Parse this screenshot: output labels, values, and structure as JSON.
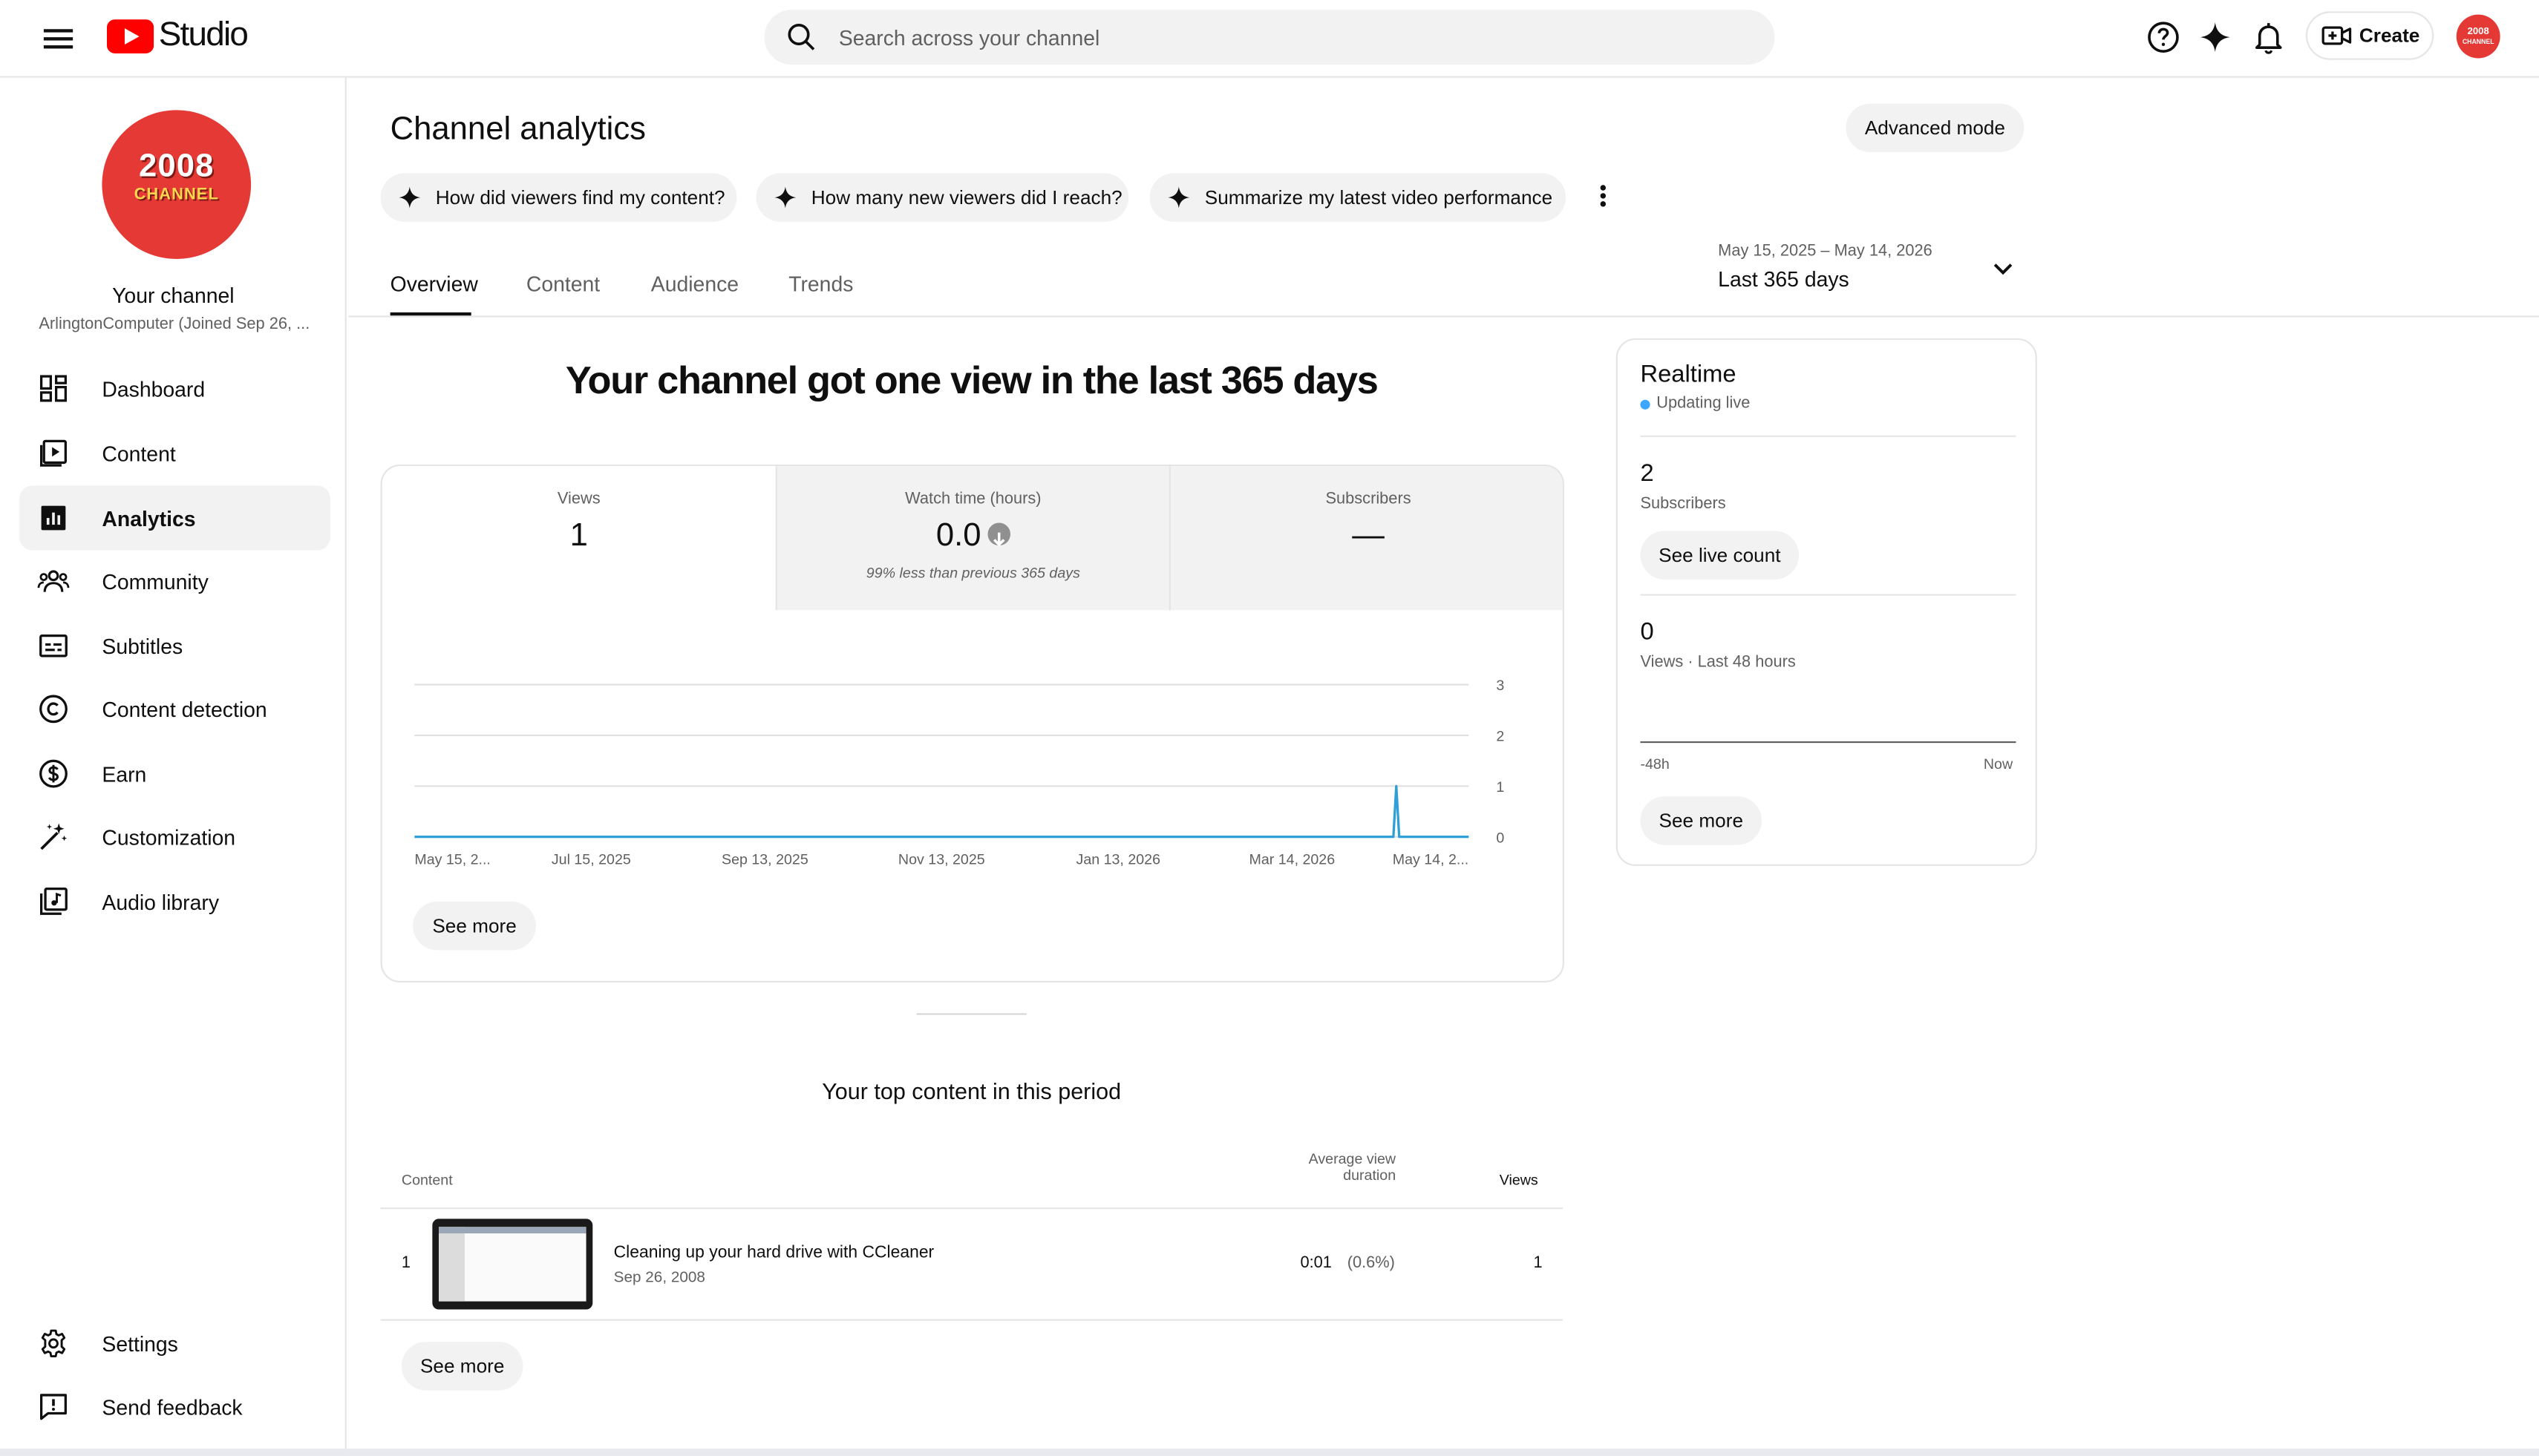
{
  "header": {
    "logo_text": "Studio",
    "search_placeholder": "Search across your channel",
    "create_label": "Create",
    "avatar_text_line1": "2008",
    "avatar_text_line2": "CHANNEL",
    "icons": [
      "menu-icon",
      "help-icon",
      "sparkle-icon",
      "notifications-icon",
      "create-video-icon"
    ]
  },
  "sidebar": {
    "avatar_line1": "2008",
    "avatar_line2": "CHANNEL",
    "title": "Your channel",
    "subtitle": "ArlingtonComputer (Joined Sep 26, ...",
    "items": [
      {
        "label": "Dashboard",
        "icon": "dashboard-icon",
        "active": false
      },
      {
        "label": "Content",
        "icon": "content-icon",
        "active": false
      },
      {
        "label": "Analytics",
        "icon": "analytics-icon",
        "active": true
      },
      {
        "label": "Community",
        "icon": "community-icon",
        "active": false
      },
      {
        "label": "Subtitles",
        "icon": "subtitles-icon",
        "active": false
      },
      {
        "label": "Content detection",
        "icon": "copyright-icon",
        "active": false
      },
      {
        "label": "Earn",
        "icon": "dollar-icon",
        "active": false
      },
      {
        "label": "Customization",
        "icon": "magic-wand-icon",
        "active": false
      },
      {
        "label": "Audio library",
        "icon": "audio-library-icon",
        "active": false
      }
    ],
    "bottom_items": [
      {
        "label": "Settings",
        "icon": "gear-icon"
      },
      {
        "label": "Send feedback",
        "icon": "feedback-icon"
      }
    ]
  },
  "main": {
    "title": "Channel analytics",
    "advanced_mode": "Advanced mode",
    "chips": [
      "How did viewers find my content?",
      "How many new viewers did I reach?",
      "Summarize my latest video performance"
    ],
    "tabs": [
      "Overview",
      "Content",
      "Audience",
      "Trends"
    ],
    "active_tab": "Overview",
    "date_range": "May 15, 2025 – May 14, 2026",
    "date_label": "Last 365 days",
    "headline": "Your channel got one view in the last 365 days",
    "metrics": [
      {
        "label": "Views",
        "value": "1",
        "note": ""
      },
      {
        "label": "Watch time (hours)",
        "value": "0.0",
        "note": "99% less than previous 365 days"
      },
      {
        "label": "Subscribers",
        "value": "—",
        "note": ""
      }
    ],
    "overview_see_more": "See more",
    "top_content": {
      "title": "Your top content in this period",
      "col_content": "Content",
      "col_avd_line1": "Average view",
      "col_avd_line2": "duration",
      "col_views": "Views",
      "rows": [
        {
          "rank": "1",
          "title": "Cleaning up your hard drive with CCleaner",
          "date": "Sep 26, 2008",
          "avd": "0:01",
          "avd_pct": "(0.6%)",
          "views": "1"
        }
      ],
      "see_more": "See more"
    }
  },
  "realtime": {
    "title": "Realtime",
    "status": "Updating live",
    "subscribers_value": "2",
    "subscribers_label": "Subscribers",
    "see_live_count": "See live count",
    "views_value": "0",
    "views_label": "Views · Last 48 hours",
    "axis_start": "-48h",
    "axis_end": "Now",
    "see_more": "See more"
  },
  "colors": {
    "accent_red": "#ff0000",
    "avatar_red": "#e53935",
    "line_blue": "#2f9fd8",
    "live_dot": "#3ea6ff"
  },
  "chart_data": {
    "type": "line",
    "title": "",
    "xlabel": "",
    "ylabel": "",
    "x_tick_labels": [
      "May 15, 2...",
      "Jul 15, 2025",
      "Sep 13, 2025",
      "Nov 13, 2025",
      "Jan 13, 2026",
      "Mar 14, 2026",
      "May 14, 2..."
    ],
    "x_tick_dates": [
      "2025-05-15",
      "2025-07-15",
      "2025-09-13",
      "2025-11-13",
      "2026-01-13",
      "2026-03-14",
      "2026-05-14"
    ],
    "x_range": [
      "2025-05-15",
      "2026-05-14"
    ],
    "y_ticks": [
      0,
      1,
      2,
      3
    ],
    "ylim": [
      0,
      3
    ],
    "grid": true,
    "series": [
      {
        "points": [
          {
            "x": "2025-05-15",
            "y": 0
          },
          {
            "x": "2026-04-18",
            "y": 0
          },
          {
            "x": "2026-04-19",
            "y": 1
          },
          {
            "x": "2026-04-20",
            "y": 0
          },
          {
            "x": "2026-05-14",
            "y": 0
          }
        ]
      }
    ]
  }
}
